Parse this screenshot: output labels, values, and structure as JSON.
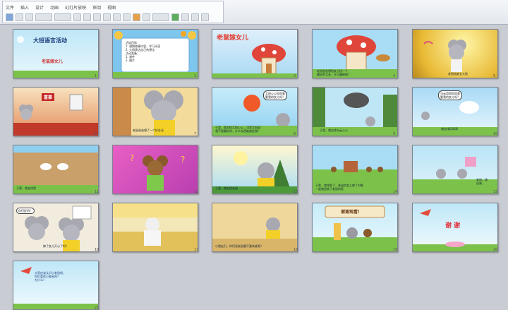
{
  "ribbon": {
    "labels": [
      "文件",
      "插入",
      "设计",
      "动画",
      "幻灯片放映",
      "审阅",
      "视图"
    ]
  },
  "slides": [
    {
      "num": "1",
      "title": "大班语言活动",
      "subtitle": "老鼠嫁女儿"
    },
    {
      "num": "2",
      "body": "活动目标：\n1. 理解故事内容，学习词语\n2. 大胆表达自己的想法\n活动准备：\n1. 课件\n2. 图片"
    },
    {
      "num": "3",
      "title": "老鼠嫁女儿"
    },
    {
      "num": "4",
      "caption": "老鼠爸爸想给女儿找一个\n最好的丈夫，什么最棒呢？"
    },
    {
      "num": "5",
      "caption": "老鼠姑娘长大啦"
    },
    {
      "num": "6",
      "sign": "喜事"
    },
    {
      "num": "7",
      "caption": "老鼠爸爸想了一个好办法"
    },
    {
      "num": "8",
      "bubble": "太阳公公你愿意\n娶我的女儿吗？",
      "caption": "于是，就去找太阳公公，可是太阳说：\n我不是最好的，什么东西能遮住我？"
    },
    {
      "num": "9",
      "caption": "于是，就去找乌云公公"
    },
    {
      "num": "10",
      "bubble": "乌云哥哥你愿意\n娶我的女儿吗？",
      "caption": "就去找风哥哥"
    },
    {
      "num": "11",
      "caption": "于是，就去找墙"
    },
    {
      "num": "12"
    },
    {
      "num": "13",
      "caption": "于是，就去找老鼠"
    },
    {
      "num": "14",
      "caption": "于是，就找到了，老鼠的女儿嫁了对象\n一起就进来了老鼠的家"
    },
    {
      "num": "15",
      "caption": "老鼠，请\n出来。"
    },
    {
      "num": "16",
      "bubble": "你们好吗？",
      "caption": "嫁了女儿开心了吗？"
    },
    {
      "num": "17"
    },
    {
      "num": "18",
      "caption": "小朋友们，你们说老鼠最不喜欢谁呢？"
    },
    {
      "num": "19",
      "banner": "谢谢观看！"
    },
    {
      "num": "20",
      "title": "谢 谢"
    },
    {
      "num": "21",
      "body": "大家应该认识小老鼠吧，\n你们喜欢小老鼠吗？\n为什么？"
    }
  ],
  "colors": {
    "accent": "#2d6fc4",
    "sky": "#8fd0f0",
    "grass": "#7cc24a",
    "mouse": "#a8a8b0"
  }
}
